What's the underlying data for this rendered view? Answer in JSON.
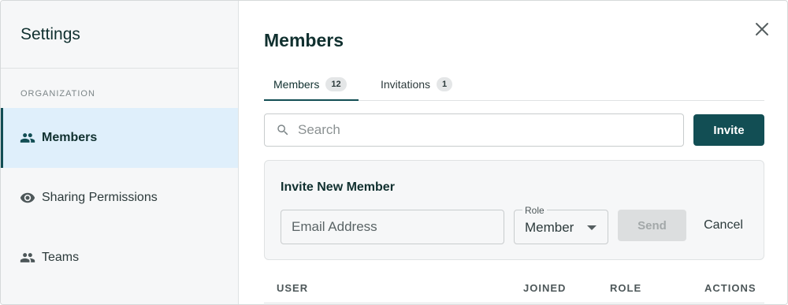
{
  "sidebar": {
    "title": "Settings",
    "section_label": "ORGANIZATION",
    "items": [
      {
        "label": "Members",
        "icon": "people-icon",
        "active": true
      },
      {
        "label": "Sharing Permissions",
        "icon": "eye-icon",
        "active": false
      },
      {
        "label": "Teams",
        "icon": "people-icon",
        "active": false
      }
    ]
  },
  "main": {
    "title": "Members",
    "tabs": [
      {
        "label": "Members",
        "count": "12",
        "active": true
      },
      {
        "label": "Invitations",
        "count": "1",
        "active": false
      }
    ],
    "search": {
      "placeholder": "Search",
      "value": ""
    },
    "invite_button": "Invite",
    "invite_panel": {
      "title": "Invite New Member",
      "email_placeholder": "Email Address",
      "role_label": "Role",
      "role_value": "Member",
      "send_label": "Send",
      "cancel_label": "Cancel"
    },
    "table": {
      "columns": [
        "USER",
        "JOINED",
        "ROLE",
        "ACTIONS"
      ]
    }
  },
  "colors": {
    "accent": "#124e54",
    "active_nav_bg": "#dfeffb",
    "sidebar_bg": "#f6f7f8"
  }
}
